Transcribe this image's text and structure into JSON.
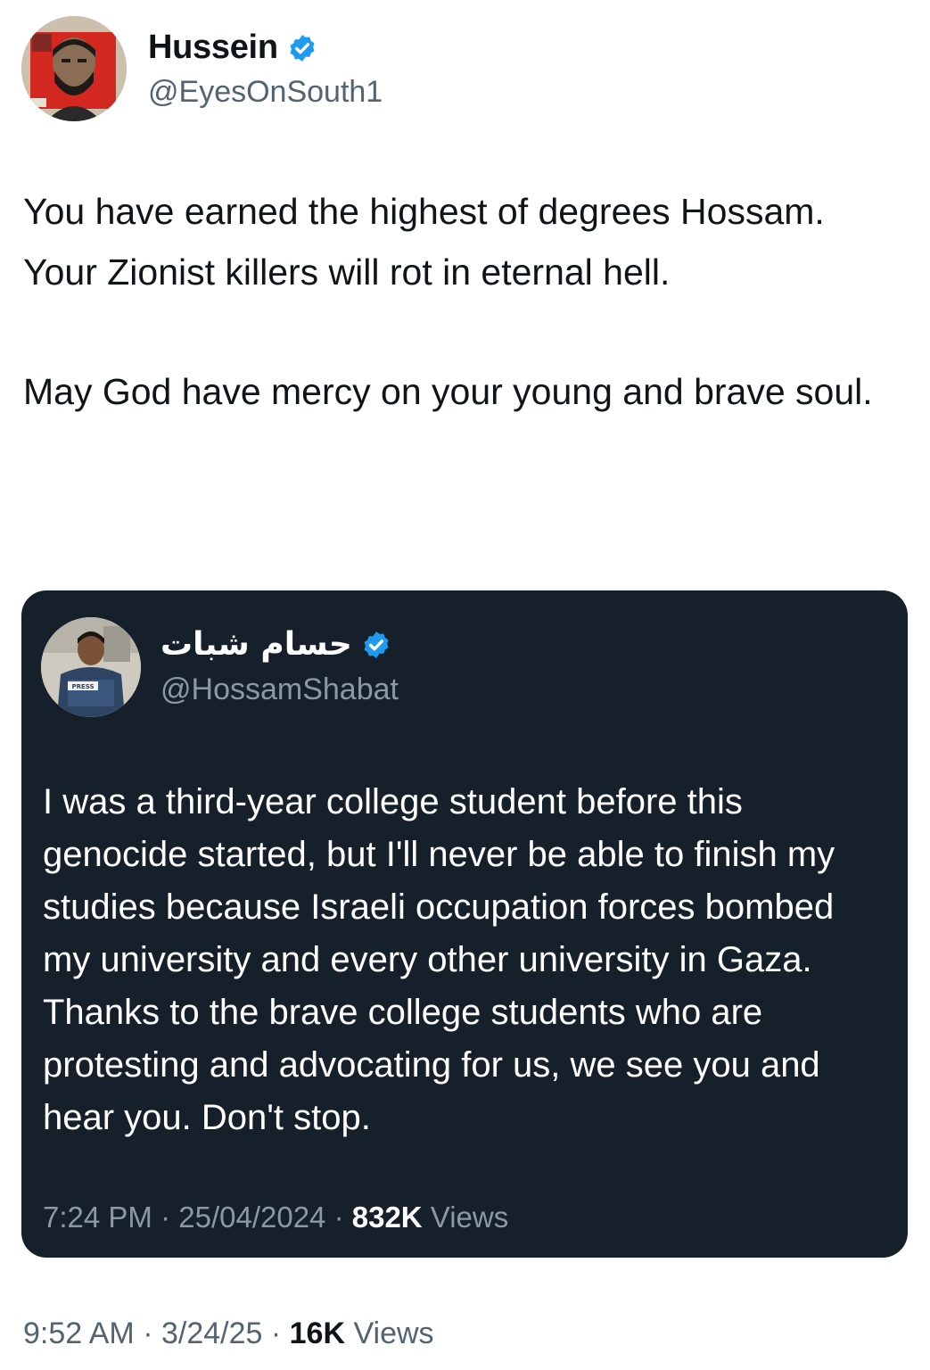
{
  "author": {
    "name": "Hussein",
    "handle": "@EyesOnSouth1",
    "verified": true
  },
  "tweet": {
    "paragraphs": [
      "You have earned the highest of degrees Hossam. Your Zionist killers will rot in eternal hell.",
      "May God have mercy on your young and brave soul."
    ],
    "time": "9:52 AM",
    "date": "3/24/25",
    "views_count": "16K",
    "views_label": "Views"
  },
  "quoted": {
    "name": "حسام شبات",
    "handle": "@HossamShabat",
    "verified": true,
    "text": "I was a third-year college student before this genocide started, but I'll never be able to finish my studies because Israeli occupation forces bombed my university and every other university in Gaza. Thanks to the brave college students who are protesting and advocating for us, we see you and hear you. Don't stop.",
    "time": "7:24 PM",
    "date": "25/04/2024",
    "views_count": "832K",
    "views_label": "Views",
    "avatar_badge": "PRESS"
  },
  "colors": {
    "verified": "#1d9bf0",
    "quote_background": "#15202b",
    "secondary_text": "#536471"
  }
}
